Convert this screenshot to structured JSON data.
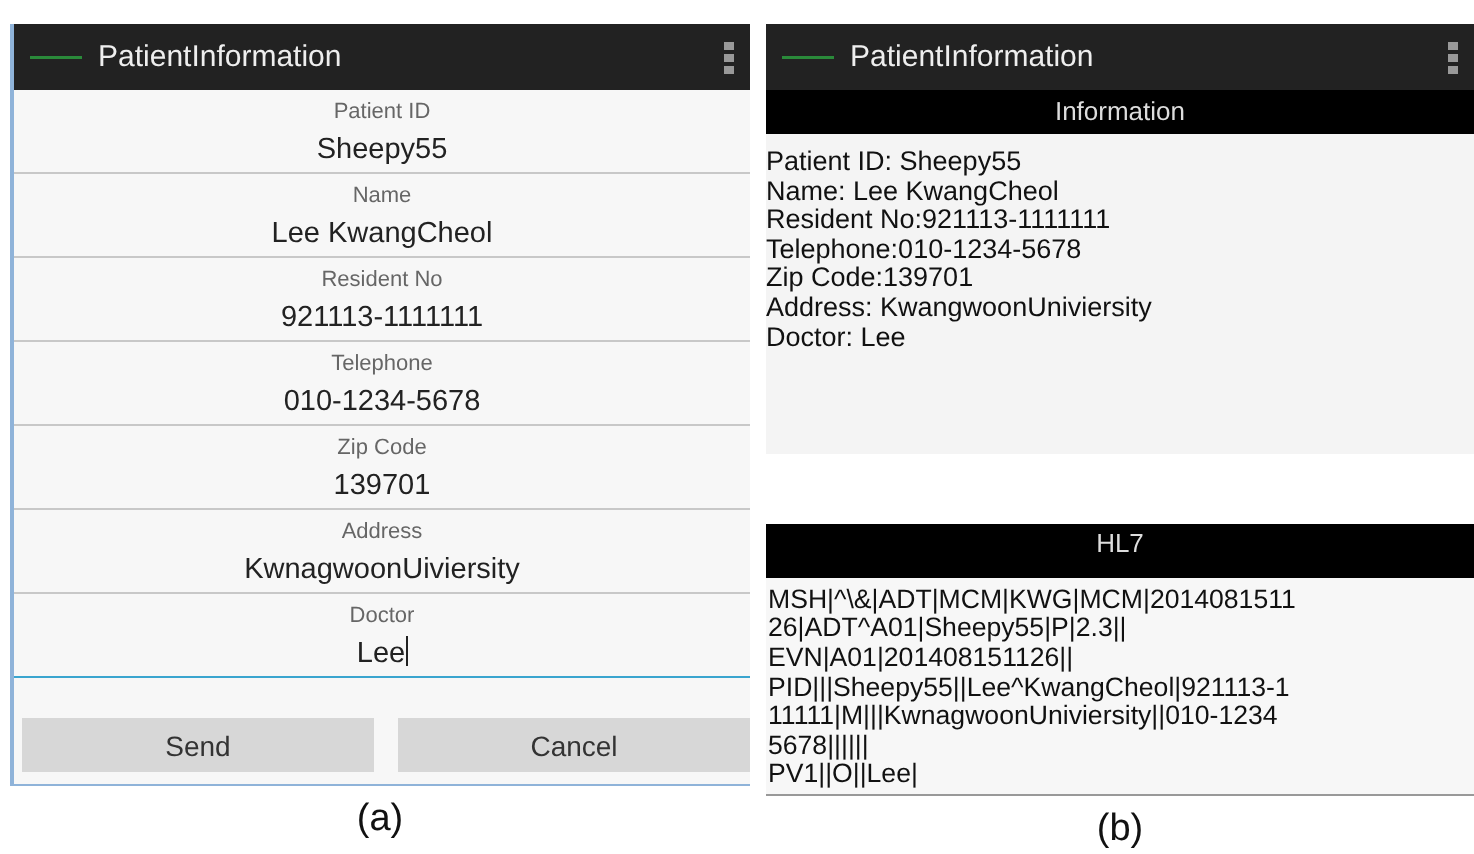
{
  "panels": [
    {
      "caption": "(a)",
      "window": {
        "title": "PatientInformation"
      },
      "fields": [
        {
          "label": "Patient ID",
          "value": "Sheepy55",
          "focused": false
        },
        {
          "label": "Name",
          "value": "Lee KwangCheol",
          "focused": false
        },
        {
          "label": "Resident No",
          "value": "921113-1111111",
          "focused": false
        },
        {
          "label": "Telephone",
          "value": "010-1234-5678",
          "focused": false
        },
        {
          "label": "Zip Code",
          "value": "139701",
          "focused": false
        },
        {
          "label": "Address",
          "value": "KwnagwoonUiviersity",
          "focused": false
        },
        {
          "label": "Doctor",
          "value": "Lee",
          "focused": true
        }
      ],
      "buttons": [
        "Send",
        "Cancel"
      ]
    },
    {
      "caption": "(b)",
      "window": {
        "title": "PatientInformation"
      },
      "sections": [
        {
          "heading": "Information",
          "lines": [
            "Patient ID: Sheepy55",
            "Name: Lee KwangCheol",
            "Resident No:921113-1111111",
            "Telephone:010-1234-5678",
            "Zip Code:139701",
            "Address: KwangwoonUniviersity",
            "Doctor: Lee"
          ]
        },
        {
          "heading": "HL7",
          "lines": [
            "MSH|^\\&|ADT|MCM|KWG|MCM|2014081511",
            "26|ADT^A01|Sheepy55|P|2.3||",
            "EVN|A01|201408151126||",
            "PID|||Sheepy55||Lee^KwangCheol|921113-1",
            "11111|M|||KwnagwoonUniviersity||010-1234",
            "5678||||||",
            "PV1||O||Lee|"
          ]
        }
      ]
    }
  ]
}
